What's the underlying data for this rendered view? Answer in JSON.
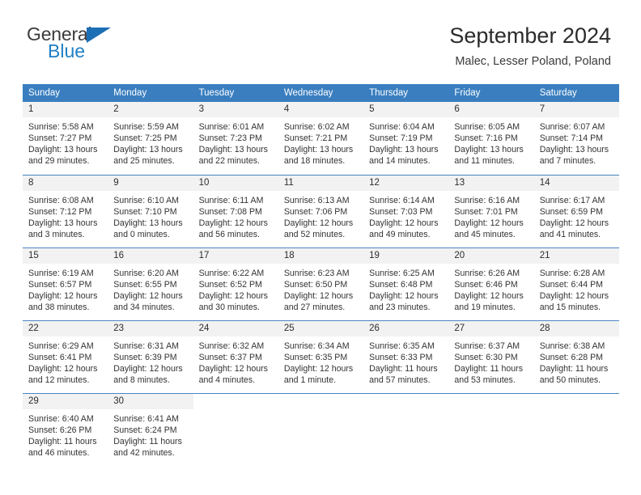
{
  "brand": {
    "name_part1": "General",
    "name_part2": "Blue"
  },
  "header": {
    "title": "September 2024",
    "location": "Malec, Lesser Poland, Poland"
  },
  "calendar": {
    "weekday_headers": [
      "Sunday",
      "Monday",
      "Tuesday",
      "Wednesday",
      "Thursday",
      "Friday",
      "Saturday"
    ],
    "colors": {
      "header_blue": "#3a7ebf",
      "row_divider": "#4a86c5",
      "daynum_band": "#f2f2f2",
      "brand_blue": "#1f7fc4"
    },
    "weeks": [
      [
        {
          "day": "1",
          "sunrise": "Sunrise: 5:58 AM",
          "sunset": "Sunset: 7:27 PM",
          "daylight_1": "Daylight: 13 hours",
          "daylight_2": "and 29 minutes."
        },
        {
          "day": "2",
          "sunrise": "Sunrise: 5:59 AM",
          "sunset": "Sunset: 7:25 PM",
          "daylight_1": "Daylight: 13 hours",
          "daylight_2": "and 25 minutes."
        },
        {
          "day": "3",
          "sunrise": "Sunrise: 6:01 AM",
          "sunset": "Sunset: 7:23 PM",
          "daylight_1": "Daylight: 13 hours",
          "daylight_2": "and 22 minutes."
        },
        {
          "day": "4",
          "sunrise": "Sunrise: 6:02 AM",
          "sunset": "Sunset: 7:21 PM",
          "daylight_1": "Daylight: 13 hours",
          "daylight_2": "and 18 minutes."
        },
        {
          "day": "5",
          "sunrise": "Sunrise: 6:04 AM",
          "sunset": "Sunset: 7:19 PM",
          "daylight_1": "Daylight: 13 hours",
          "daylight_2": "and 14 minutes."
        },
        {
          "day": "6",
          "sunrise": "Sunrise: 6:05 AM",
          "sunset": "Sunset: 7:16 PM",
          "daylight_1": "Daylight: 13 hours",
          "daylight_2": "and 11 minutes."
        },
        {
          "day": "7",
          "sunrise": "Sunrise: 6:07 AM",
          "sunset": "Sunset: 7:14 PM",
          "daylight_1": "Daylight: 13 hours",
          "daylight_2": "and 7 minutes."
        }
      ],
      [
        {
          "day": "8",
          "sunrise": "Sunrise: 6:08 AM",
          "sunset": "Sunset: 7:12 PM",
          "daylight_1": "Daylight: 13 hours",
          "daylight_2": "and 3 minutes."
        },
        {
          "day": "9",
          "sunrise": "Sunrise: 6:10 AM",
          "sunset": "Sunset: 7:10 PM",
          "daylight_1": "Daylight: 13 hours",
          "daylight_2": "and 0 minutes."
        },
        {
          "day": "10",
          "sunrise": "Sunrise: 6:11 AM",
          "sunset": "Sunset: 7:08 PM",
          "daylight_1": "Daylight: 12 hours",
          "daylight_2": "and 56 minutes."
        },
        {
          "day": "11",
          "sunrise": "Sunrise: 6:13 AM",
          "sunset": "Sunset: 7:06 PM",
          "daylight_1": "Daylight: 12 hours",
          "daylight_2": "and 52 minutes."
        },
        {
          "day": "12",
          "sunrise": "Sunrise: 6:14 AM",
          "sunset": "Sunset: 7:03 PM",
          "daylight_1": "Daylight: 12 hours",
          "daylight_2": "and 49 minutes."
        },
        {
          "day": "13",
          "sunrise": "Sunrise: 6:16 AM",
          "sunset": "Sunset: 7:01 PM",
          "daylight_1": "Daylight: 12 hours",
          "daylight_2": "and 45 minutes."
        },
        {
          "day": "14",
          "sunrise": "Sunrise: 6:17 AM",
          "sunset": "Sunset: 6:59 PM",
          "daylight_1": "Daylight: 12 hours",
          "daylight_2": "and 41 minutes."
        }
      ],
      [
        {
          "day": "15",
          "sunrise": "Sunrise: 6:19 AM",
          "sunset": "Sunset: 6:57 PM",
          "daylight_1": "Daylight: 12 hours",
          "daylight_2": "and 38 minutes."
        },
        {
          "day": "16",
          "sunrise": "Sunrise: 6:20 AM",
          "sunset": "Sunset: 6:55 PM",
          "daylight_1": "Daylight: 12 hours",
          "daylight_2": "and 34 minutes."
        },
        {
          "day": "17",
          "sunrise": "Sunrise: 6:22 AM",
          "sunset": "Sunset: 6:52 PM",
          "daylight_1": "Daylight: 12 hours",
          "daylight_2": "and 30 minutes."
        },
        {
          "day": "18",
          "sunrise": "Sunrise: 6:23 AM",
          "sunset": "Sunset: 6:50 PM",
          "daylight_1": "Daylight: 12 hours",
          "daylight_2": "and 27 minutes."
        },
        {
          "day": "19",
          "sunrise": "Sunrise: 6:25 AM",
          "sunset": "Sunset: 6:48 PM",
          "daylight_1": "Daylight: 12 hours",
          "daylight_2": "and 23 minutes."
        },
        {
          "day": "20",
          "sunrise": "Sunrise: 6:26 AM",
          "sunset": "Sunset: 6:46 PM",
          "daylight_1": "Daylight: 12 hours",
          "daylight_2": "and 19 minutes."
        },
        {
          "day": "21",
          "sunrise": "Sunrise: 6:28 AM",
          "sunset": "Sunset: 6:44 PM",
          "daylight_1": "Daylight: 12 hours",
          "daylight_2": "and 15 minutes."
        }
      ],
      [
        {
          "day": "22",
          "sunrise": "Sunrise: 6:29 AM",
          "sunset": "Sunset: 6:41 PM",
          "daylight_1": "Daylight: 12 hours",
          "daylight_2": "and 12 minutes."
        },
        {
          "day": "23",
          "sunrise": "Sunrise: 6:31 AM",
          "sunset": "Sunset: 6:39 PM",
          "daylight_1": "Daylight: 12 hours",
          "daylight_2": "and 8 minutes."
        },
        {
          "day": "24",
          "sunrise": "Sunrise: 6:32 AM",
          "sunset": "Sunset: 6:37 PM",
          "daylight_1": "Daylight: 12 hours",
          "daylight_2": "and 4 minutes."
        },
        {
          "day": "25",
          "sunrise": "Sunrise: 6:34 AM",
          "sunset": "Sunset: 6:35 PM",
          "daylight_1": "Daylight: 12 hours",
          "daylight_2": "and 1 minute."
        },
        {
          "day": "26",
          "sunrise": "Sunrise: 6:35 AM",
          "sunset": "Sunset: 6:33 PM",
          "daylight_1": "Daylight: 11 hours",
          "daylight_2": "and 57 minutes."
        },
        {
          "day": "27",
          "sunrise": "Sunrise: 6:37 AM",
          "sunset": "Sunset: 6:30 PM",
          "daylight_1": "Daylight: 11 hours",
          "daylight_2": "and 53 minutes."
        },
        {
          "day": "28",
          "sunrise": "Sunrise: 6:38 AM",
          "sunset": "Sunset: 6:28 PM",
          "daylight_1": "Daylight: 11 hours",
          "daylight_2": "and 50 minutes."
        }
      ],
      [
        {
          "day": "29",
          "sunrise": "Sunrise: 6:40 AM",
          "sunset": "Sunset: 6:26 PM",
          "daylight_1": "Daylight: 11 hours",
          "daylight_2": "and 46 minutes."
        },
        {
          "day": "30",
          "sunrise": "Sunrise: 6:41 AM",
          "sunset": "Sunset: 6:24 PM",
          "daylight_1": "Daylight: 11 hours",
          "daylight_2": "and 42 minutes."
        },
        {
          "day": "",
          "sunrise": "",
          "sunset": "",
          "daylight_1": "",
          "daylight_2": ""
        },
        {
          "day": "",
          "sunrise": "",
          "sunset": "",
          "daylight_1": "",
          "daylight_2": ""
        },
        {
          "day": "",
          "sunrise": "",
          "sunset": "",
          "daylight_1": "",
          "daylight_2": ""
        },
        {
          "day": "",
          "sunrise": "",
          "sunset": "",
          "daylight_1": "",
          "daylight_2": ""
        },
        {
          "day": "",
          "sunrise": "",
          "sunset": "",
          "daylight_1": "",
          "daylight_2": ""
        }
      ]
    ]
  }
}
